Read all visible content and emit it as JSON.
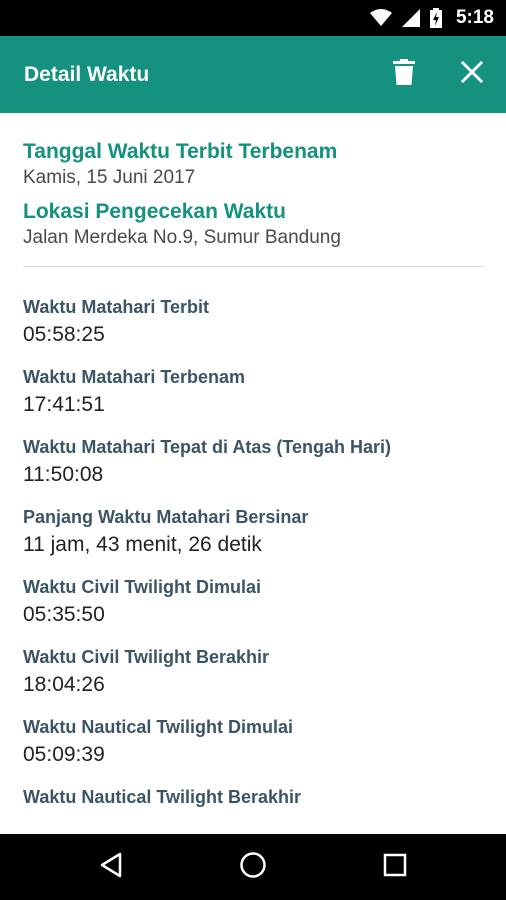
{
  "status_bar": {
    "time": "5:18",
    "icons": [
      "wifi-icon",
      "cell-signal-icon",
      "battery-charging-icon"
    ]
  },
  "app_bar": {
    "title": "Detail Waktu",
    "actions": [
      "delete-icon",
      "close-icon"
    ]
  },
  "summary": {
    "date_heading": "Tanggal Waktu Terbit Terbenam",
    "date_value": "Kamis, 15 Juni 2017",
    "location_heading": "Lokasi Pengecekan Waktu",
    "location_value": "Jalan Merdeka No.9, Sumur Bandung"
  },
  "details": [
    {
      "label": "Waktu Matahari Terbit",
      "value": "05:58:25"
    },
    {
      "label": "Waktu Matahari Terbenam",
      "value": "17:41:51"
    },
    {
      "label": "Waktu Matahari Tepat di Atas (Tengah Hari)",
      "value": "11:50:08"
    },
    {
      "label": "Panjang Waktu Matahari Bersinar",
      "value": "11 jam, 43 menit, 26 detik"
    },
    {
      "label": "Waktu Civil Twilight Dimulai",
      "value": "05:35:50"
    },
    {
      "label": "Waktu Civil Twilight Berakhir",
      "value": "18:04:26"
    },
    {
      "label": "Waktu Nautical Twilight Dimulai",
      "value": "05:09:39"
    },
    {
      "label": "Waktu Nautical Twilight Berakhir",
      "value": ""
    }
  ],
  "nav_bar": {
    "buttons": [
      "back-icon",
      "home-icon",
      "recents-icon"
    ]
  },
  "colors": {
    "primary": "#14917f",
    "heading": "#14917f",
    "label": "#3b5566"
  }
}
